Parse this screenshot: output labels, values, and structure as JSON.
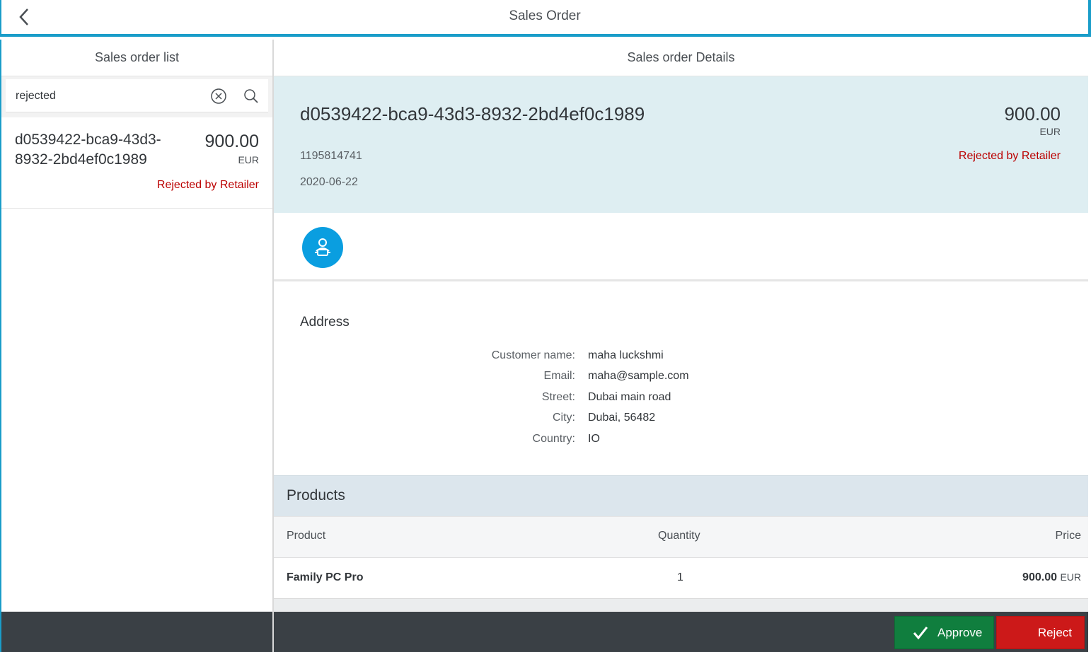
{
  "shell": {
    "title": "Sales Order",
    "back_icon": "chevron-left-icon"
  },
  "master": {
    "header": "Sales order list",
    "search": {
      "value": "rejected",
      "placeholder": "",
      "clear_icon": "clear-circle-icon",
      "search_icon": "search-icon"
    },
    "items": [
      {
        "id": "d0539422-bca9-43d3-8932-2bd4ef0c1989",
        "amount": "900.00",
        "currency": "EUR",
        "status": "Rejected by Retailer"
      }
    ]
  },
  "detail": {
    "header": "Sales order Details",
    "object": {
      "title": "d0539422-bca9-43d3-8932-2bd4ef0c1989",
      "number": "1195814741",
      "date": "2020-06-22",
      "amount": "900.00",
      "currency": "EUR",
      "status": "Rejected by Retailer"
    },
    "tab_icon": "customer-icon",
    "address": {
      "title": "Address",
      "fields": [
        {
          "label": "Customer name:",
          "value": "maha luckshmi"
        },
        {
          "label": "Email:",
          "value": "maha@sample.com"
        },
        {
          "label": "Street:",
          "value": "Dubai main road"
        },
        {
          "label": "City:",
          "value": "Dubai, 56482"
        },
        {
          "label": "Country:",
          "value": "IO"
        }
      ]
    },
    "products": {
      "title": "Products",
      "columns": [
        "Product",
        "Quantity",
        "Price"
      ],
      "rows": [
        {
          "product": "Family PC Pro",
          "quantity": "1",
          "price": "900.00",
          "currency": "EUR"
        }
      ]
    },
    "footer": {
      "approve_label": "Approve",
      "reject_label": "Reject"
    }
  },
  "colors": {
    "accent": "#1a9dc9",
    "header_bg": "#deeef2",
    "negative": "#bb0000",
    "approve": "#107e3e",
    "reject": "#cc1919",
    "footer": "#3a4045"
  }
}
